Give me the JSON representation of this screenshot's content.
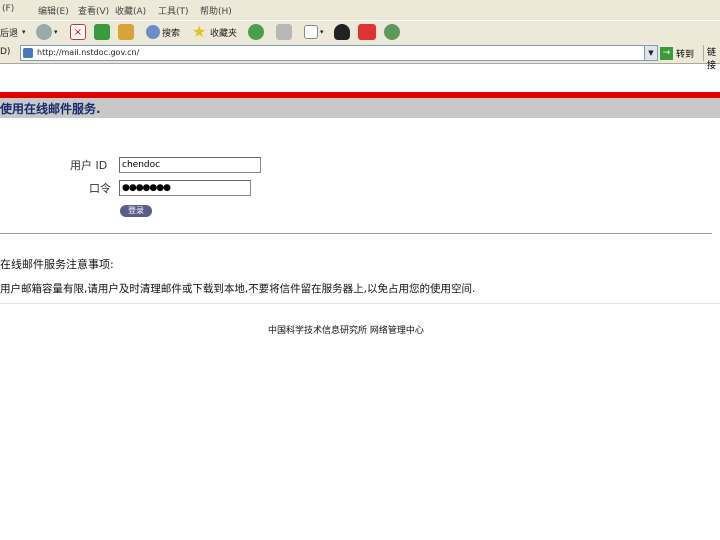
{
  "menu": {
    "items": [
      "(F)",
      "编辑(E)",
      "查看(V)",
      "收藏(A)",
      "工具(T)",
      "帮助(H)"
    ]
  },
  "toolbar": {
    "back_label": "后退",
    "search_label": "搜索",
    "favorites_label": "收藏夹"
  },
  "address": {
    "label": "D)",
    "url": "http://mail.nstdoc.gov.cn/",
    "go_label": "转到",
    "links_label": "链接"
  },
  "page": {
    "header_text": "使用在线邮件服务.",
    "user_id_label": "用户 ID",
    "user_id_value": "chendoc",
    "password_label": "口令",
    "password_value": "●●●●●●●",
    "login_label": "登录",
    "notice_title": "在线邮件服务注意事项:",
    "notice_text": "用户邮箱容量有限,请用户及时清理邮件或下载到本地,不要将信件留在服务器上,以免占用您的使用空间.",
    "footer": "中国科学技术信息研究所 网络管理中心"
  },
  "colors": {
    "accent_red": "#e00000",
    "header_grey": "#c8c8c8",
    "header_text": "#1a2a6c",
    "login_button": "#5a5d8a"
  }
}
